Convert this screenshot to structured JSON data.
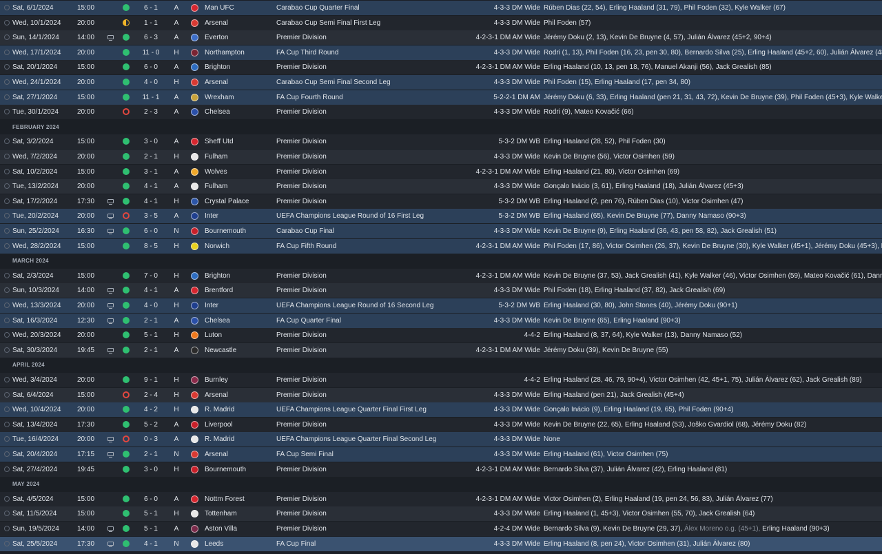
{
  "colors": {
    "win": "#2fbf71",
    "loss": "#e2473f",
    "draw": "#f0b429",
    "row_dark": "#22262d",
    "row_light": "#2a2f37",
    "row_highlight": "#2c4059",
    "row_selected": "#3a5270"
  },
  "fixtures": [
    {
      "kind": "match",
      "date": "Sat, 6/1/2024",
      "time": "15:00",
      "tv": false,
      "result": "W",
      "score": "6 - 1",
      "venue": "A",
      "opponent": "Man UFC",
      "crest_color": "#d6262f",
      "competition": "Carabao Cup Quarter Final",
      "formation": "4-3-3 DM Wide",
      "scorers": "Rúben Dias (22, 54), Erling Haaland (31, 79), Phil Foden (32), Kyle Walker (67)",
      "style": "hl"
    },
    {
      "kind": "match",
      "date": "Wed, 10/1/2024",
      "time": "20:00",
      "tv": false,
      "result": "D",
      "score": "1 - 1",
      "venue": "A",
      "opponent": "Arsenal",
      "crest_color": "#d93a33",
      "competition": "Carabao Cup Semi Final First Leg",
      "formation": "4-3-3 DM Wide",
      "scorers": "Phil Foden (57)",
      "style": "a"
    },
    {
      "kind": "match",
      "date": "Sun, 14/1/2024",
      "time": "14:00",
      "tv": true,
      "result": "W",
      "score": "6 - 3",
      "venue": "A",
      "opponent": "Everton",
      "crest_color": "#3c6ec8",
      "competition": "Premier Division",
      "formation": "4-2-3-1 DM AM Wide",
      "scorers": "Jérémy Doku (2, 13), Kevin De Bruyne (4, 57), Julián Álvarez (45+2, 90+4)",
      "style": "b"
    },
    {
      "kind": "match",
      "date": "Wed, 17/1/2024",
      "time": "20:00",
      "tv": false,
      "result": "W",
      "score": "11 - 0",
      "venue": "H",
      "opponent": "Northampton",
      "crest_color": "#7a2433",
      "competition": "FA Cup Third Round",
      "formation": "4-3-3 DM Wide",
      "scorers": "Rodri (1, 13), Phil Foden (16, 23, pen 30, 80), Bernardo Silva (25), Erling Haaland (45+2, 60), Julián Álvarez (48),...",
      "style": "hl"
    },
    {
      "kind": "match",
      "date": "Sat, 20/1/2024",
      "time": "15:00",
      "tv": false,
      "result": "W",
      "score": "6 - 0",
      "venue": "A",
      "opponent": "Brighton",
      "crest_color": "#2d6cc0",
      "competition": "Premier Division",
      "formation": "4-2-3-1 DM AM Wide",
      "scorers": "Erling Haaland (10, 13, pen 18, 76), Manuel Akanji (56), Jack Grealish (85)",
      "style": "a"
    },
    {
      "kind": "match",
      "date": "Wed, 24/1/2024",
      "time": "20:00",
      "tv": false,
      "result": "W",
      "score": "4 - 0",
      "venue": "H",
      "opponent": "Arsenal",
      "crest_color": "#d93a33",
      "competition": "Carabao Cup Semi Final Second Leg",
      "formation": "4-3-3 DM Wide",
      "scorers": "Phil Foden (15), Erling Haaland (17, pen 34, 80)",
      "style": "hl"
    },
    {
      "kind": "match",
      "date": "Sat, 27/1/2024",
      "time": "15:00",
      "tv": false,
      "result": "W",
      "score": "11 - 1",
      "venue": "A",
      "opponent": "Wrexham",
      "crest_color": "#c8a23a",
      "competition": "FA Cup Fourth Round",
      "formation": "5-2-2-1 DM AM",
      "scorers": "Jérémy Doku (6, 33), Erling Haaland (pen 21, 31, 43, 72), Kevin De Bruyne (39), Phil Foden (45+3), Kyle Walker (...",
      "style": "hl"
    },
    {
      "kind": "match",
      "date": "Tue, 30/1/2024",
      "time": "20:00",
      "tv": false,
      "result": "L",
      "score": "2 - 3",
      "venue": "A",
      "opponent": "Chelsea",
      "crest_color": "#2a4fa8",
      "competition": "Premier Division",
      "formation": "4-3-3 DM Wide",
      "scorers": "Rodri (9), Mateo Kovačić (66)",
      "style": "a"
    },
    {
      "kind": "month",
      "label": "FEBRUARY 2024"
    },
    {
      "kind": "match",
      "date": "Sat, 3/2/2024",
      "time": "15:00",
      "tv": false,
      "result": "W",
      "score": "3 - 0",
      "venue": "A",
      "opponent": "Sheff Utd",
      "crest_color": "#d6262f",
      "competition": "Premier Division",
      "formation": "5-3-2 DM WB",
      "scorers": "Erling Haaland (28, 52), Phil Foden (30)",
      "style": "a"
    },
    {
      "kind": "match",
      "date": "Wed, 7/2/2024",
      "time": "20:00",
      "tv": false,
      "result": "W",
      "score": "2 - 1",
      "venue": "H",
      "opponent": "Fulham",
      "crest_color": "#e8e8e8",
      "competition": "Premier Division",
      "formation": "4-3-3 DM Wide",
      "scorers": "Kevin De Bruyne (56), Victor Osimhen (59)",
      "style": "b"
    },
    {
      "kind": "match",
      "date": "Sat, 10/2/2024",
      "time": "15:00",
      "tv": false,
      "result": "W",
      "score": "3 - 1",
      "venue": "A",
      "opponent": "Wolves",
      "crest_color": "#f0a82a",
      "competition": "Premier Division",
      "formation": "4-2-3-1 DM AM Wide",
      "scorers": "Erling Haaland (21, 80), Victor Osimhen (69)",
      "style": "a"
    },
    {
      "kind": "match",
      "date": "Tue, 13/2/2024",
      "time": "20:00",
      "tv": false,
      "result": "W",
      "score": "4 - 1",
      "venue": "A",
      "opponent": "Fulham",
      "crest_color": "#e8e8e8",
      "competition": "Premier Division",
      "formation": "4-3-3 DM Wide",
      "scorers": "Gonçalo Inácio (3, 61), Erling Haaland (18), Julián Álvarez (45+3)",
      "style": "b"
    },
    {
      "kind": "match",
      "date": "Sat, 17/2/2024",
      "time": "17:30",
      "tv": true,
      "result": "W",
      "score": "4 - 1",
      "venue": "H",
      "opponent": "Crystal Palace",
      "crest_color": "#2c55a8",
      "competition": "Premier Division",
      "formation": "5-3-2 DM WB",
      "scorers": "Erling Haaland (2, pen 76), Rúben Dias (10), Victor Osimhen (47)",
      "style": "a"
    },
    {
      "kind": "match",
      "date": "Tue, 20/2/2024",
      "time": "20:00",
      "tv": true,
      "result": "L",
      "score": "3 - 5",
      "venue": "A",
      "opponent": "Inter",
      "crest_color": "#1f3f8f",
      "competition": "UEFA Champions League Round of 16  First Leg",
      "formation": "5-3-2 DM WB",
      "scorers": "Erling Haaland (65), Kevin De Bruyne (77), Danny Namaso (90+3)",
      "style": "hl"
    },
    {
      "kind": "match",
      "date": "Sun, 25/2/2024",
      "time": "16:30",
      "tv": true,
      "result": "W",
      "score": "6 - 0",
      "venue": "N",
      "opponent": "Bournemouth",
      "crest_color": "#c8202a",
      "competition": "Carabao Cup Final",
      "formation": "4-3-3 DM Wide",
      "scorers": "Kevin De Bruyne (9), Erling Haaland (36, 43, pen 58, 82), Jack Grealish (51)",
      "style": "hl"
    },
    {
      "kind": "match",
      "date": "Wed, 28/2/2024",
      "time": "15:00",
      "tv": false,
      "result": "W",
      "score": "8 - 5",
      "venue": "H",
      "opponent": "Norwich",
      "crest_color": "#e8d21f",
      "competition": "FA Cup Fifth Round",
      "formation": "4-2-3-1 DM AM Wide",
      "scorers": "Phil Foden (17, 86), Victor Osimhen (26, 37), Kevin De Bruyne (30), Kyle Walker (45+1), Jérémy Doku (45+3), Ben",
      "style": "hl"
    },
    {
      "kind": "month",
      "label": "MARCH 2024"
    },
    {
      "kind": "match",
      "date": "Sat, 2/3/2024",
      "time": "15:00",
      "tv": false,
      "result": "W",
      "score": "7 - 0",
      "venue": "H",
      "opponent": "Brighton",
      "crest_color": "#2d6cc0",
      "competition": "Premier Division",
      "formation": "4-2-3-1 DM AM Wide",
      "scorers": "Kevin De Bruyne (37, 53), Jack Grealish (41), Kyle Walker (46), Victor Osimhen (59), Mateo Kovačić (61), Danny...",
      "style": "a"
    },
    {
      "kind": "match",
      "date": "Sun, 10/3/2024",
      "time": "14:00",
      "tv": true,
      "result": "W",
      "score": "4 - 1",
      "venue": "A",
      "opponent": "Brentford",
      "crest_color": "#d6262f",
      "competition": "Premier Division",
      "formation": "4-3-3 DM Wide",
      "scorers": "Phil Foden (18), Erling Haaland (37, 82), Jack Grealish (69)",
      "style": "b"
    },
    {
      "kind": "match",
      "date": "Wed, 13/3/2024",
      "time": "20:00",
      "tv": true,
      "result": "W",
      "score": "4 - 0",
      "venue": "H",
      "opponent": "Inter",
      "crest_color": "#1f3f8f",
      "competition": "UEFA Champions League Round of 16  Second Leg",
      "formation": "5-3-2 DM WB",
      "scorers": "Erling Haaland (30, 80), John Stones (40), Jérémy Doku (90+1)",
      "style": "hl"
    },
    {
      "kind": "match",
      "date": "Sat, 16/3/2024",
      "time": "12:30",
      "tv": true,
      "result": "W",
      "score": "2 - 1",
      "venue": "A",
      "opponent": "Chelsea",
      "crest_color": "#2a4fa8",
      "competition": "FA Cup Quarter Final",
      "formation": "4-3-3 DM Wide",
      "scorers": "Kevin De Bruyne (65), Erling Haaland (90+3)",
      "style": "hl"
    },
    {
      "kind": "match",
      "date": "Wed, 20/3/2024",
      "time": "20:00",
      "tv": false,
      "result": "W",
      "score": "5 - 1",
      "venue": "H",
      "opponent": "Luton",
      "crest_color": "#f07a1e",
      "competition": "Premier Division",
      "formation": "4-4-2",
      "scorers": "Erling Haaland (8, 37, 64), Kyle Walker (13), Danny Namaso (52)",
      "style": "a"
    },
    {
      "kind": "match",
      "date": "Sat, 30/3/2024",
      "time": "19:45",
      "tv": true,
      "result": "W",
      "score": "2 - 1",
      "venue": "A",
      "opponent": "Newcastle",
      "crest_color": "#2b2b2b",
      "competition": "Premier Division",
      "formation": "4-2-3-1 DM AM Wide",
      "scorers": "Jérémy Doku (39), Kevin De Bruyne (55)",
      "style": "b"
    },
    {
      "kind": "month",
      "label": "APRIL 2024"
    },
    {
      "kind": "match",
      "date": "Wed, 3/4/2024",
      "time": "20:00",
      "tv": false,
      "result": "W",
      "score": "9 - 1",
      "venue": "H",
      "opponent": "Burnley",
      "crest_color": "#8a2a4a",
      "competition": "Premier Division",
      "formation": "4-4-2",
      "scorers": "Erling Haaland (28, 46, 79, 90+4), Victor Osimhen (42, 45+1, 75), Julián Álvarez (62), Jack Grealish (89)",
      "style": "a"
    },
    {
      "kind": "match",
      "date": "Sat, 6/4/2024",
      "time": "15:00",
      "tv": false,
      "result": "L",
      "score": "2 - 4",
      "venue": "H",
      "opponent": "Arsenal",
      "crest_color": "#d93a33",
      "competition": "Premier Division",
      "formation": "4-3-3 DM Wide",
      "scorers": "Erling Haaland (pen 21), Jack Grealish (45+4)",
      "style": "b"
    },
    {
      "kind": "match",
      "date": "Wed, 10/4/2024",
      "time": "20:00",
      "tv": false,
      "result": "W",
      "score": "4 - 2",
      "venue": "H",
      "opponent": "R. Madrid",
      "crest_color": "#e8e8e8",
      "competition": "UEFA Champions League Quarter Final First Leg",
      "formation": "4-3-3 DM Wide",
      "scorers": "Gonçalo Inácio (9), Erling Haaland (19, 65), Phil Foden (90+4)",
      "style": "hl"
    },
    {
      "kind": "match",
      "date": "Sat, 13/4/2024",
      "time": "17:30",
      "tv": false,
      "result": "W",
      "score": "5 - 2",
      "venue": "A",
      "opponent": "Liverpool",
      "crest_color": "#c8202a",
      "competition": "Premier Division",
      "formation": "4-3-3 DM Wide",
      "scorers": "Kevin De Bruyne (22, 65), Erling Haaland (53), Joško Gvardiol (68), Jérémy Doku (82)",
      "style": "a"
    },
    {
      "kind": "match",
      "date": "Tue, 16/4/2024",
      "time": "20:00",
      "tv": true,
      "result": "L",
      "score": "0 - 3",
      "venue": "A",
      "opponent": "R. Madrid",
      "crest_color": "#e8e8e8",
      "competition": "UEFA Champions League Quarter Final Second Leg",
      "formation": "4-3-3 DM Wide",
      "scorers": "None",
      "style": "hl"
    },
    {
      "kind": "match",
      "date": "Sat, 20/4/2024",
      "time": "17:15",
      "tv": true,
      "result": "W",
      "score": "2 - 1",
      "venue": "N",
      "opponent": "Arsenal",
      "crest_color": "#d93a33",
      "competition": "FA Cup Semi Final",
      "formation": "4-3-3 DM Wide",
      "scorers": "Erling Haaland (61), Victor Osimhen (75)",
      "style": "hl"
    },
    {
      "kind": "match",
      "date": "Sat, 27/4/2024",
      "time": "19:45",
      "tv": false,
      "result": "W",
      "score": "3 - 0",
      "venue": "H",
      "opponent": "Bournemouth",
      "crest_color": "#c8202a",
      "competition": "Premier Division",
      "formation": "4-2-3-1 DM AM Wide",
      "scorers": "Bernardo Silva (37), Julián Álvarez (42), Erling Haaland (81)",
      "style": "a"
    },
    {
      "kind": "month",
      "label": "MAY 2024"
    },
    {
      "kind": "match",
      "date": "Sat, 4/5/2024",
      "time": "15:00",
      "tv": false,
      "result": "W",
      "score": "6 - 0",
      "venue": "A",
      "opponent": "Nottm Forest",
      "crest_color": "#d6262f",
      "competition": "Premier Division",
      "formation": "4-2-3-1 DM AM Wide",
      "scorers": "Victor Osimhen (2), Erling Haaland (19, pen 24, 56, 83), Julián Álvarez (77)",
      "style": "a"
    },
    {
      "kind": "match",
      "date": "Sat, 11/5/2024",
      "time": "15:00",
      "tv": false,
      "result": "W",
      "score": "5 - 1",
      "venue": "H",
      "opponent": "Tottenham",
      "crest_color": "#e8e8e8",
      "competition": "Premier Division",
      "formation": "4-3-3 DM Wide",
      "scorers": "Erling Haaland (1, 45+3), Victor Osimhen (55, 70), Jack Grealish (64)",
      "style": "b"
    },
    {
      "kind": "match",
      "date": "Sun, 19/5/2024",
      "time": "14:00",
      "tv": true,
      "result": "W",
      "score": "5 - 1",
      "venue": "A",
      "opponent": "Aston Villa",
      "crest_color": "#7a2a4a",
      "competition": "Premier Division",
      "formation": "4-2-4 DM Wide",
      "scorers": "Bernardo Silva (9), Kevin De Bruyne (29, 37),",
      "scorers_muted": " Álex Moreno o.g. (45+1),",
      "scorers_after": " Erling Haaland (90+3)",
      "style": "a"
    },
    {
      "kind": "match",
      "date": "Sat, 25/5/2024",
      "time": "17:30",
      "tv": true,
      "result": "W",
      "score": "4 - 1",
      "venue": "N",
      "opponent": "Leeds",
      "crest_color": "#e8e8e8",
      "competition": "FA Cup Final",
      "formation": "4-3-3 DM Wide",
      "scorers": "Erling Haaland (8, pen 24), Victor Osimhen (31), Julián Álvarez (80)",
      "style": "sel"
    }
  ]
}
